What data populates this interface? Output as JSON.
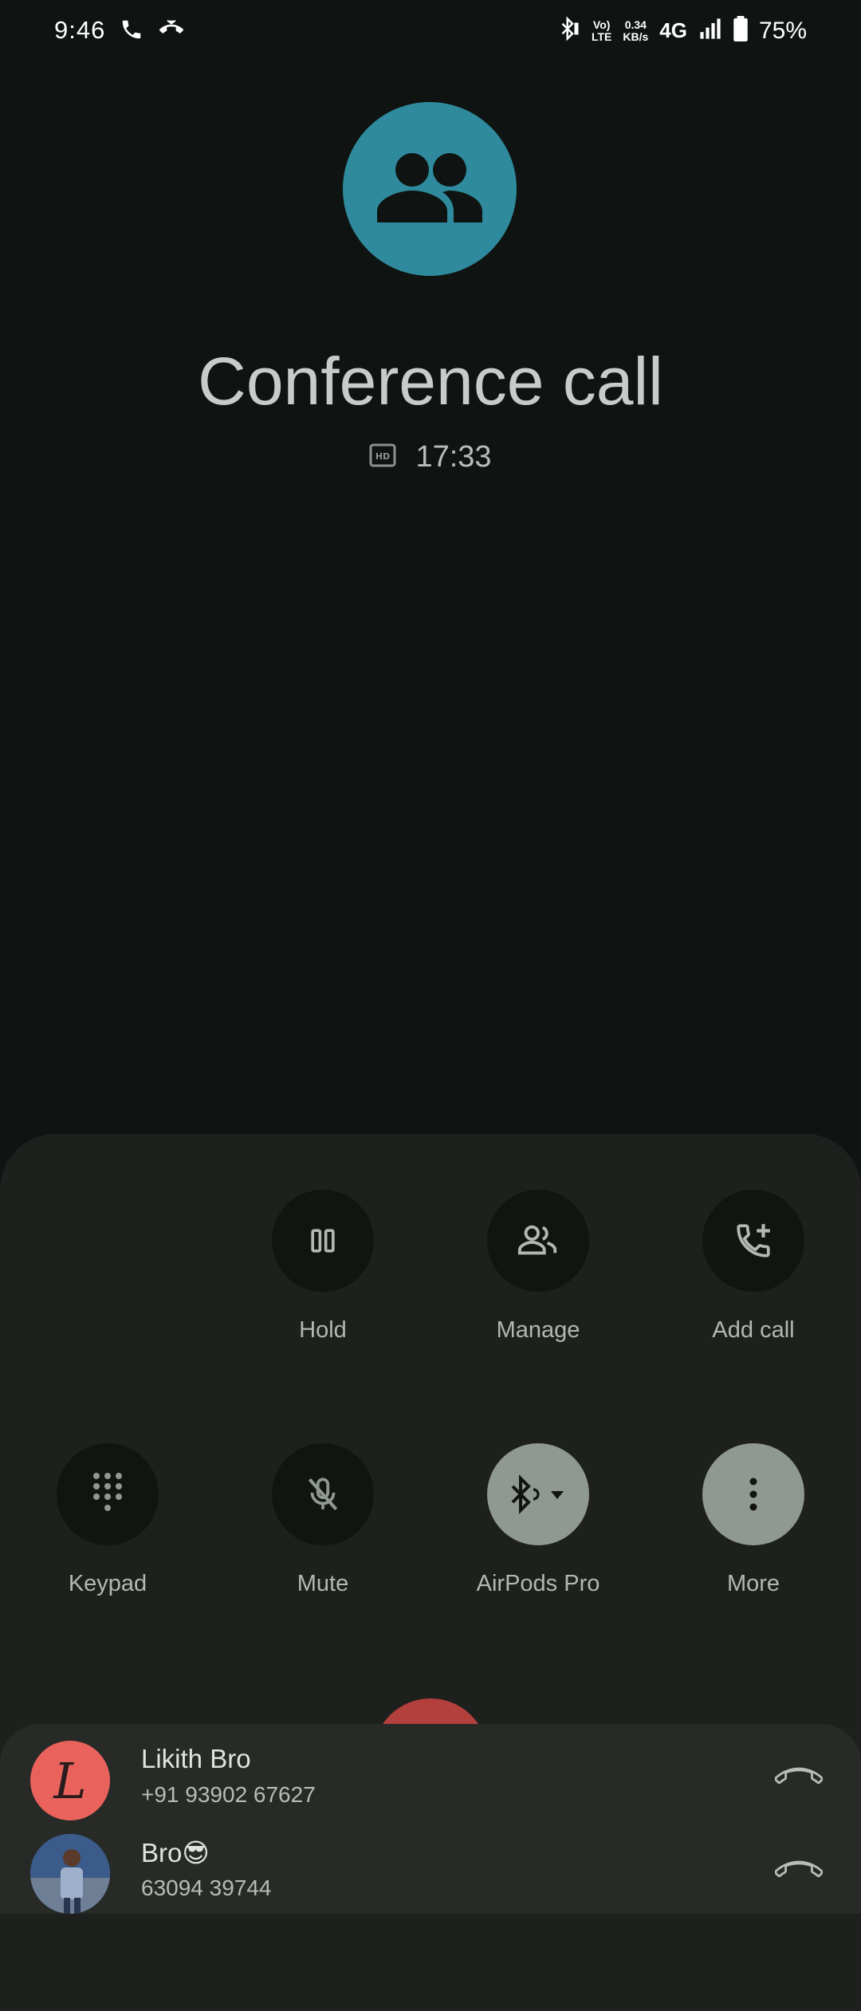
{
  "status_bar": {
    "time": "9:46",
    "volte_top": "Vo)",
    "volte_bottom": "LTE",
    "speed_top": "0.34",
    "speed_bottom": "KB/s",
    "network": "4G",
    "battery": "75%",
    "icons": [
      "phone-icon",
      "call-forwarding-icon",
      "bluetooth-battery-icon",
      "signal-icon",
      "battery-icon"
    ]
  },
  "call": {
    "title": "Conference call",
    "hd_icon": "hd-icon",
    "timer": "17:33",
    "avatar_color": "#2e8a9c"
  },
  "controls": {
    "hold": "Hold",
    "manage": "Manage",
    "add_call": "Add call",
    "keypad": "Keypad",
    "mute": "Mute",
    "audio": "AirPods Pro",
    "more": "More"
  },
  "participants": [
    {
      "initial": "L",
      "name": "Likith Bro",
      "number": "+91 93902 67627",
      "avatar_color": "#e9625c"
    },
    {
      "initial": "",
      "name": "Bro😎",
      "number": "63094 39744",
      "avatar_color": "#4a6f9a"
    }
  ],
  "colors": {
    "background": "#0f1412",
    "panel": "#1e201e",
    "end_call": "#b3403c",
    "active_button": "#8f9891"
  }
}
